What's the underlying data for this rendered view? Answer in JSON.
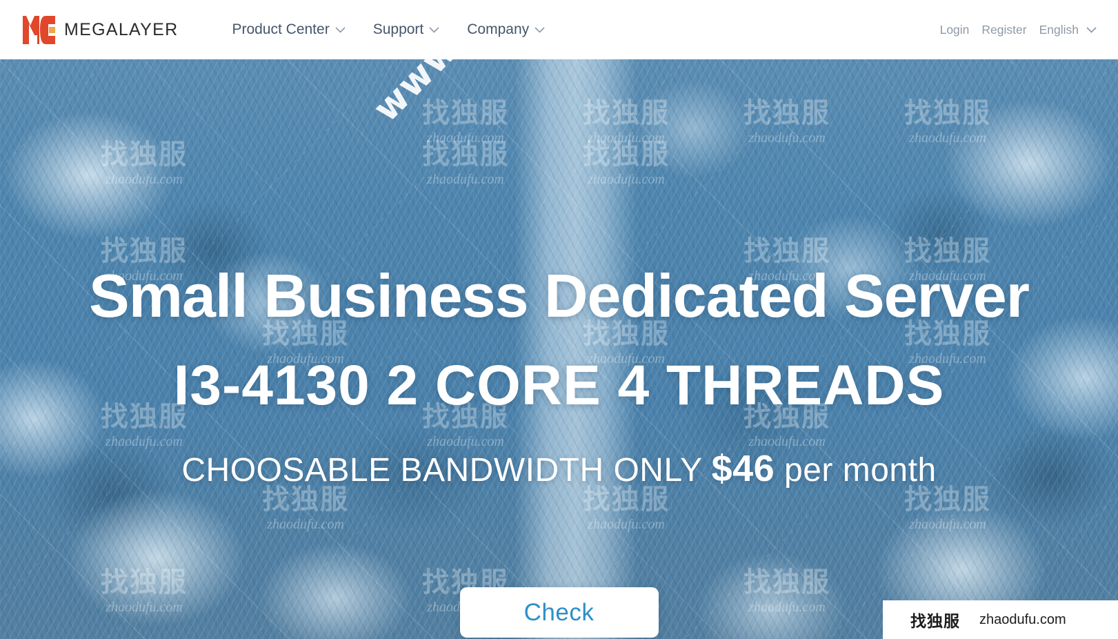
{
  "header": {
    "brand": {
      "name": "MEGALAYER",
      "logo_icon": "megalayer-logo-icon",
      "logo_color": "#e0472b"
    },
    "nav": [
      {
        "label": "Product Center",
        "icon": "chevron-down-icon"
      },
      {
        "label": "Support",
        "icon": "chevron-down-icon"
      },
      {
        "label": "Company",
        "icon": "chevron-down-icon"
      }
    ],
    "user": {
      "login_label": "Login",
      "register_label": "Register",
      "language_label": "English",
      "language_icon": "chevron-down-icon"
    }
  },
  "hero": {
    "headline_1": "Small Business Dedicated Server",
    "headline_2": "I3-4130 2 CORE 4 THREADS",
    "subhead_prefix": "CHOOSABLE BANDWIDTH ONLY",
    "subhead_price": "$46",
    "subhead_suffix": "per month",
    "cta_label": "Check",
    "cta_text_color": "#2d8fc7",
    "background_alt": "aerial view of snow covered forest with road"
  },
  "watermarks": {
    "diagonal": "www.Veldc.com",
    "tile_cn": "找独服",
    "tile_url": "zhaodufu.com"
  },
  "corner_badge": {
    "cn": "找独服",
    "url": "zhaodufu.com"
  }
}
